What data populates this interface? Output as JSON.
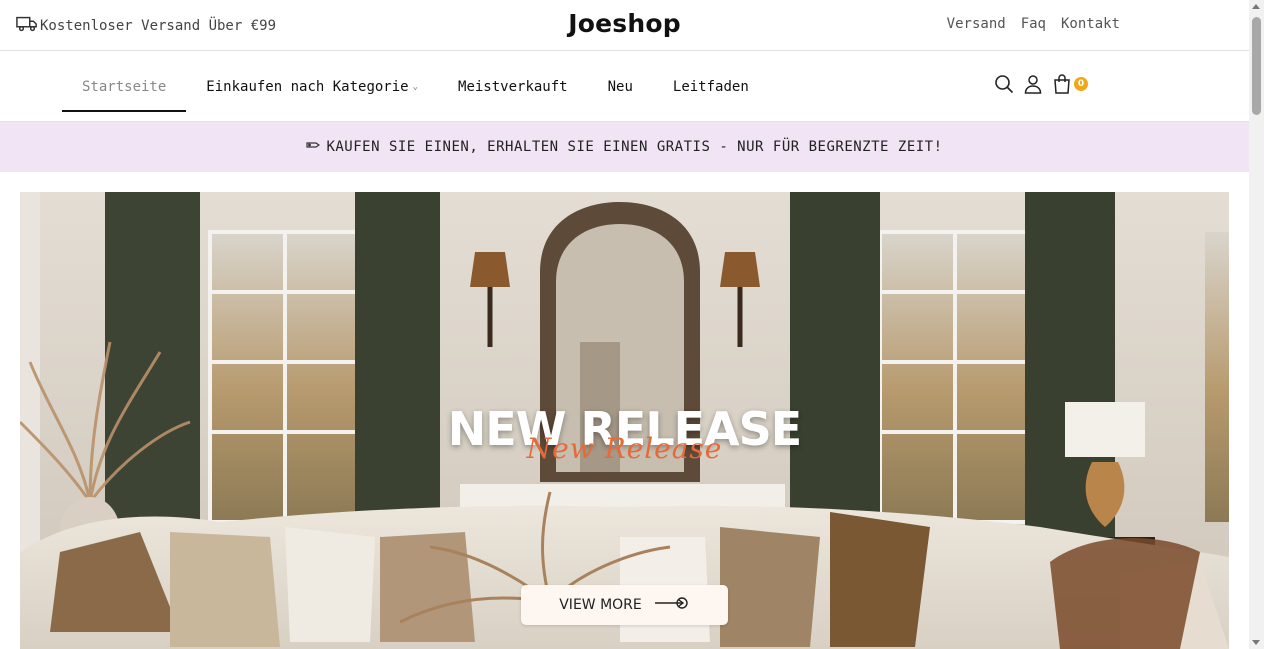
{
  "topbar": {
    "shipping_text": "Kostenloser Versand Über €99",
    "shipping_icon": "truck-icon",
    "logo": "Joeshop",
    "links": [
      "Versand",
      "Faq",
      "Kontakt"
    ]
  },
  "nav": {
    "items": [
      {
        "label": "Startseite",
        "active": true
      },
      {
        "label": "Einkaufen nach Kategorie",
        "has_dropdown": true
      },
      {
        "label": "Meistverkauft"
      },
      {
        "label": "Neu"
      },
      {
        "label": "Leitfaden"
      }
    ],
    "icons": [
      "search-icon",
      "user-icon",
      "cart-icon"
    ],
    "cart_count": "0"
  },
  "announcement": {
    "icon": "sale-tag-icon",
    "text": "KAUFEN SIE EINEN, ERHALTEN SIE EINEN GRATIS - NUR FÜR BEGRENZTE ZEIT!"
  },
  "hero": {
    "title": "NEW RELEASE",
    "script_text": "New Release",
    "button_label": "VIEW MORE",
    "button_icon": "arrow-right-icon"
  },
  "colors": {
    "announcement_bg": "#f1e4f4",
    "accent_script": "#e56a3a",
    "cart_badge": "#f2a71b"
  }
}
